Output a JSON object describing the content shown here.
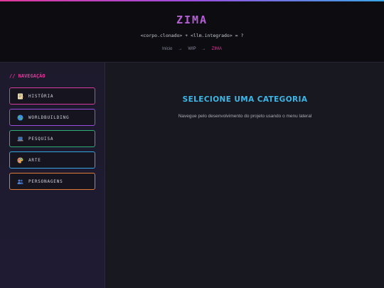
{
  "header": {
    "brand": "ZIMA",
    "tagline": "<corpo.clonado> + <llm.integrado> = ?",
    "breadcrumbs": [
      "Início",
      "WIP",
      "ZIMA"
    ],
    "breadcrumb_sep": "→"
  },
  "sidebar": {
    "title": "// NAVEGAÇÃO",
    "items": [
      {
        "label": "HISTÓRIA",
        "icon": "memo-icon",
        "color": "#d63ba0"
      },
      {
        "label": "WORLDBUILDING",
        "icon": "globe-icon",
        "color": "#9b4de0"
      },
      {
        "label": "PESQUISA",
        "icon": "laptop-icon",
        "color": "#2fae78"
      },
      {
        "label": "ARTE",
        "icon": "palette-icon",
        "color": "#36a7e0"
      },
      {
        "label": "PERSONAGENS",
        "icon": "people-icon",
        "color": "#e07a3a"
      }
    ]
  },
  "main": {
    "title": "SELECIONE UMA CATEGORIA",
    "subtitle": "Navegue pelo desenvolvimento do projeto usando o menu lateral"
  }
}
